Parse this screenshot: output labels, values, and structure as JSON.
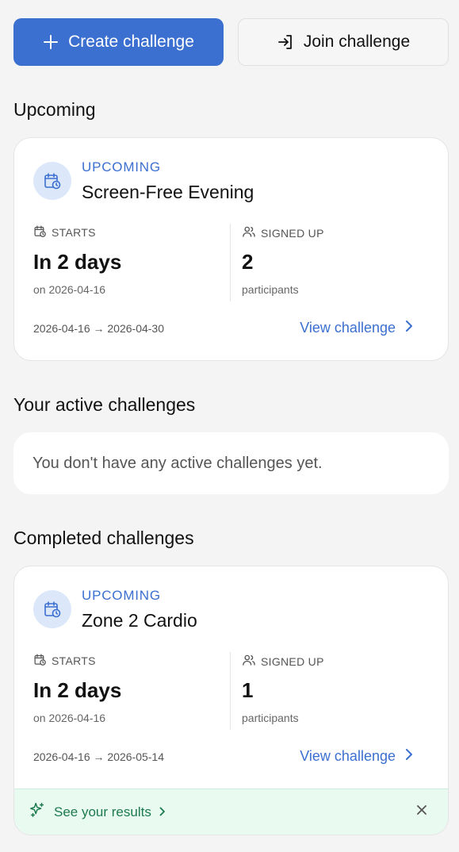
{
  "actions": {
    "create_label": "Create challenge",
    "join_label": "Join challenge"
  },
  "sections": {
    "upcoming_title": "Upcoming",
    "active_title": "Your active challenges",
    "active_empty": "You don't have any active challenges yet.",
    "completed_title": "Completed challenges"
  },
  "upcoming_card": {
    "status": "UPCOMING",
    "title": "Screen-Free Evening",
    "starts_label": "STARTS",
    "starts_value": "In 2 days",
    "starts_sub": "on 2026-04-16",
    "signed_label": "SIGNED UP",
    "signed_value": "2",
    "signed_sub": "participants",
    "date_range": "2026-04-16 → 2026-04-30",
    "view_label": "View challenge"
  },
  "completed_card": {
    "status": "UPCOMING",
    "title": "Zone 2 Cardio",
    "starts_label": "STARTS",
    "starts_value": "In 2 days",
    "starts_sub": "on 2026-04-16",
    "signed_label": "SIGNED UP",
    "signed_value": "1",
    "signed_sub": "participants",
    "date_range": "2026-04-16 → 2026-05-14",
    "view_label": "View challenge",
    "results_label": "See your results"
  },
  "colors": {
    "primary": "#3b6fd0",
    "success": "#1c7a4e",
    "success_bg": "#e9faf1"
  }
}
